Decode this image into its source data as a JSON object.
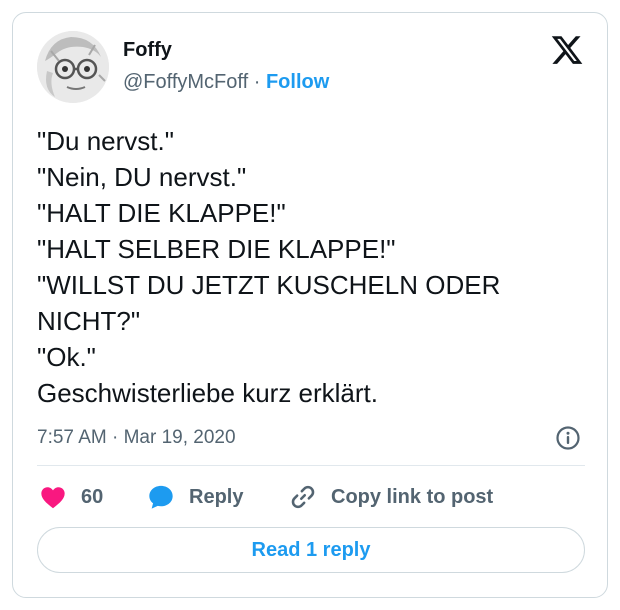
{
  "author": {
    "name": "Foffy",
    "handle": "@FoffyMcFoff",
    "separator": "·",
    "follow_label": "Follow"
  },
  "tweet": {
    "lines": [
      "\"Du nervst.\"",
      "\"Nein, DU nervst.\"",
      "\"HALT DIE KLAPPE!\"",
      "\"HALT SELBER DIE KLAPPE!\"",
      "\"WILLST DU JETZT KUSCHELN ODER",
      "NICHT?\"",
      "\"Ok.\"",
      "Geschwisterliebe kurz erklärt."
    ],
    "timestamp": "7:57 AM · Mar 19, 2020"
  },
  "actions": {
    "like_count": "60",
    "reply_label": "Reply",
    "copy_label": "Copy link to post"
  },
  "read_replies_label": "Read 1 reply",
  "icons": {
    "logo": "x-logo-icon",
    "info": "info-icon",
    "like": "heart-icon",
    "reply": "speech-bubble-icon",
    "copy": "link-icon"
  },
  "colors": {
    "accent": "#1d9bf0",
    "like": "#f91880",
    "secondary_text": "#536471",
    "border": "#cfd9de"
  }
}
